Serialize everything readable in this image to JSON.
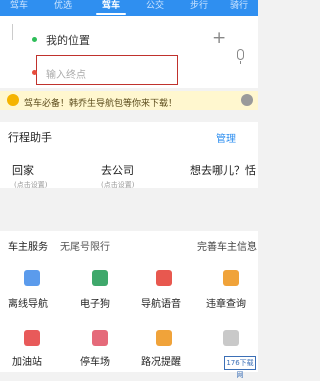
{
  "tabs": [
    {
      "label": "驾车"
    },
    {
      "label": "优选"
    },
    {
      "label": "驾车"
    },
    {
      "label": "公交"
    },
    {
      "label": "步行"
    },
    {
      "label": "骑行"
    }
  ],
  "route": {
    "start_label": "我的位置",
    "end_placeholder": "输入终点"
  },
  "banner": {
    "text": "驾车必备！韩乔生导航包等你来下载！"
  },
  "assist": {
    "title": "行程助手",
    "manage_label": "管理",
    "places": [
      {
        "name": "回家",
        "sub": "(点击设置)"
      },
      {
        "name": "去公司",
        "sub": "(点击设置)"
      },
      {
        "name": "想去哪儿？恬",
        "sub": ""
      }
    ]
  },
  "services": {
    "title": "车主服务",
    "subtitle": "无尾号限行",
    "right_label": "完善车主信息",
    "items": [
      {
        "label": "离线导航",
        "icon": "offline-nav-icon"
      },
      {
        "label": "电子狗",
        "icon": "electronic-dog-icon"
      },
      {
        "label": "导航语音",
        "icon": "nav-voice-icon"
      },
      {
        "label": "违章查询",
        "icon": "violation-query-icon"
      },
      {
        "label": "加油站",
        "icon": "gas-station-icon"
      },
      {
        "label": "停车场",
        "icon": "parking-icon"
      },
      {
        "label": "路况提醒",
        "icon": "traffic-alert-icon"
      },
      {
        "label": "",
        "icon": "more-icon"
      }
    ]
  },
  "watermark": {
    "text": "176下载网"
  },
  "colors": {
    "primary": "#2f8ff0",
    "start_dot": "#2ebd59",
    "end_dot": "#e74c3c",
    "highlight_border": "#c0322d",
    "banner_bg": "#fff7cf"
  }
}
